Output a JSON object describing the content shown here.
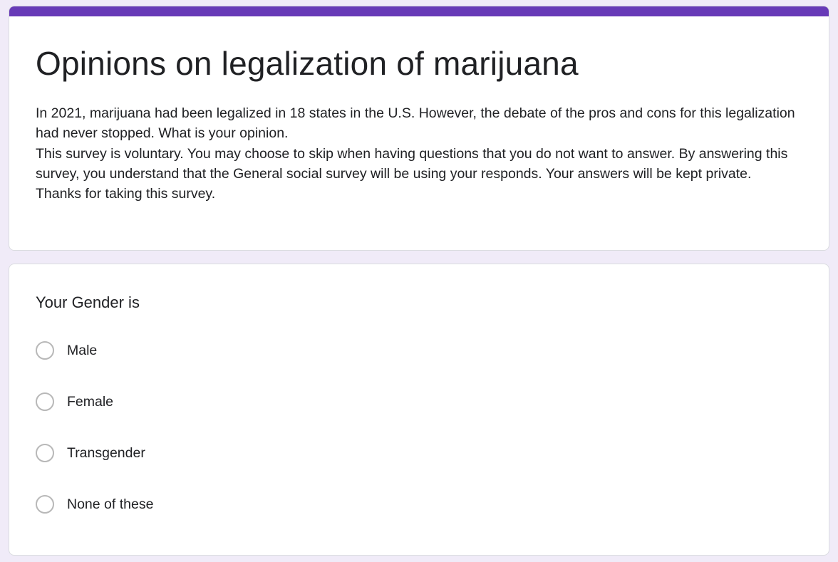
{
  "form": {
    "accent_color": "#673ab7",
    "background_color": "#f0ebf8",
    "title": "Opinions on legalization of marijuana",
    "description": [
      "In 2021, marijuana had been legalized in 18 states in the U.S. However, the debate of the pros and cons for this legalization had never stopped. What is your opinion.",
      "This survey is voluntary. You may choose to skip when having questions that you do not want to answer. By answering this survey, you understand that the General social survey will be using your responds. Your answers will be kept private.",
      "Thanks for taking this survey."
    ]
  },
  "question": {
    "title": "Your Gender is",
    "type": "radio",
    "selected": null,
    "options": [
      {
        "label": "Male",
        "icon": "radio-unchecked-icon"
      },
      {
        "label": "Female",
        "icon": "radio-unchecked-icon"
      },
      {
        "label": "Transgender",
        "icon": "radio-unchecked-icon"
      },
      {
        "label": "None of these",
        "icon": "radio-unchecked-icon"
      }
    ]
  }
}
